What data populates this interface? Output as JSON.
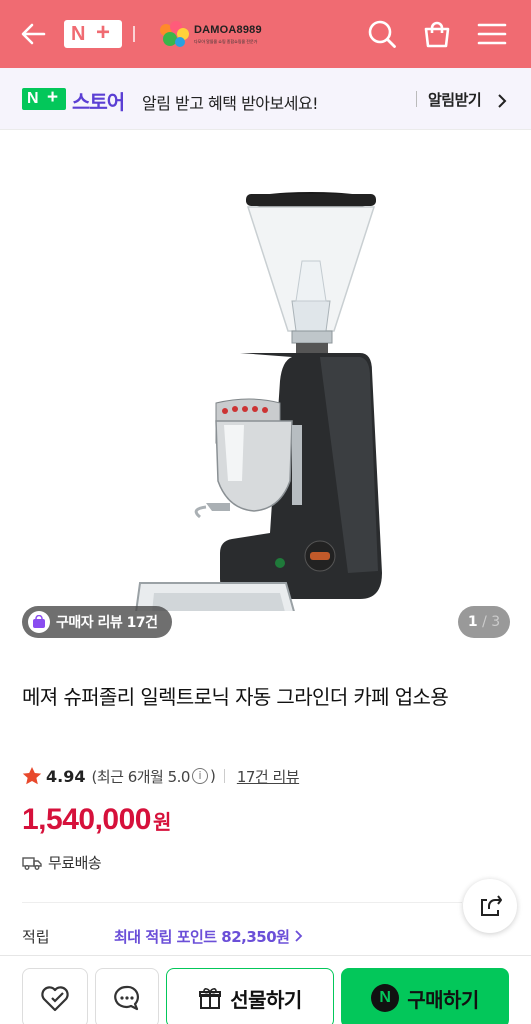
{
  "header": {
    "logo_n": "N",
    "logo_plus": "+",
    "shop_name": "DAMOA8989",
    "shop_tagline": "다모아 알뜰몰 쇼핑 종합쇼핑몰 전문가",
    "icons": [
      "back-arrow-icon",
      "search-icon",
      "shopping-bag-icon",
      "menu-icon"
    ],
    "background_color": "#f06b72"
  },
  "store_banner": {
    "logo_n": "N",
    "logo_plus": "+",
    "store_label": "스토어",
    "message": "알림 받고 혜택 받아보세요!",
    "action_label": "알림받기",
    "accent_color": "#5b3fd4"
  },
  "gallery": {
    "review_badge": "구매자 리뷰 17건",
    "current": "1",
    "total": "/ 3"
  },
  "product": {
    "title": "메져 슈퍼졸리 일렉트로닉 자동 그라인더 카페 업소용",
    "rating_score": "4.94",
    "rating_recent": "(최근 6개월 5.0",
    "rating_recent_close": ")",
    "info_glyph": "i",
    "review_link": "17건 리뷰",
    "price": "1,540,000",
    "currency": "원",
    "delivery": "무료배송",
    "points_label": "적립",
    "points_value": "최대 적립 포인트 82,350원",
    "price_color": "#d6113b"
  },
  "bottom_bar": {
    "gift_label": "선물하기",
    "buy_label": "구매하기",
    "npay_glyph": "N",
    "buy_color": "#03c75a"
  }
}
